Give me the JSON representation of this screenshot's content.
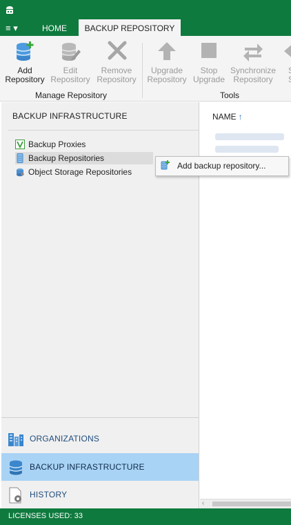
{
  "tabs": {
    "menu_glyph": "≡ ▾",
    "home": "HOME",
    "active": "BACKUP REPOSITORY"
  },
  "ribbon": {
    "groups": [
      {
        "label": "Manage Repository"
      },
      {
        "label": "Tools"
      }
    ],
    "buttons": [
      {
        "line1": "Add",
        "line2": "Repository",
        "icon": "add-repository-icon",
        "enabled": true
      },
      {
        "line1": "Edit",
        "line2": "Repository",
        "icon": "edit-repository-icon",
        "enabled": false
      },
      {
        "line1": "Remove",
        "line2": "Repository",
        "icon": "remove-repository-icon",
        "enabled": false
      },
      {
        "line1": "Upgrade",
        "line2": "Repository",
        "icon": "upgrade-repository-icon",
        "enabled": false
      },
      {
        "line1": "Stop",
        "line2": "Upgrade",
        "icon": "stop-upgrade-icon",
        "enabled": false
      },
      {
        "line1": "Synchronize",
        "line2": "Repository",
        "icon": "synchronize-repository-icon",
        "enabled": false
      },
      {
        "line1": "S",
        "line2": "S",
        "icon": "partial-button-icon",
        "enabled": false
      }
    ]
  },
  "left_pane": {
    "header": "BACKUP INFRASTRUCTURE",
    "tree": [
      {
        "label": "Backup Proxies",
        "icon": "proxy-icon"
      },
      {
        "label": "Backup Repositories",
        "icon": "repository-icon",
        "selected": true
      },
      {
        "label": "Object Storage Repositories",
        "icon": "object-storage-icon"
      }
    ],
    "nav": [
      {
        "label": "ORGANIZATIONS",
        "icon": "organizations-icon"
      },
      {
        "label": "BACKUP INFRASTRUCTURE",
        "icon": "database-icon",
        "active": true
      },
      {
        "label": "HISTORY",
        "icon": "history-icon"
      }
    ]
  },
  "right_pane": {
    "column_name": "NAME",
    "sort_glyph": "↑"
  },
  "context_menu": {
    "items": [
      {
        "label": "Add backup repository..."
      }
    ]
  },
  "status": {
    "text": "LICENSES USED: 33"
  },
  "colors": {
    "brand_green": "#0f7a3e",
    "nav_active": "#a9d3f5",
    "accent_blue": "#2a6ebb"
  }
}
